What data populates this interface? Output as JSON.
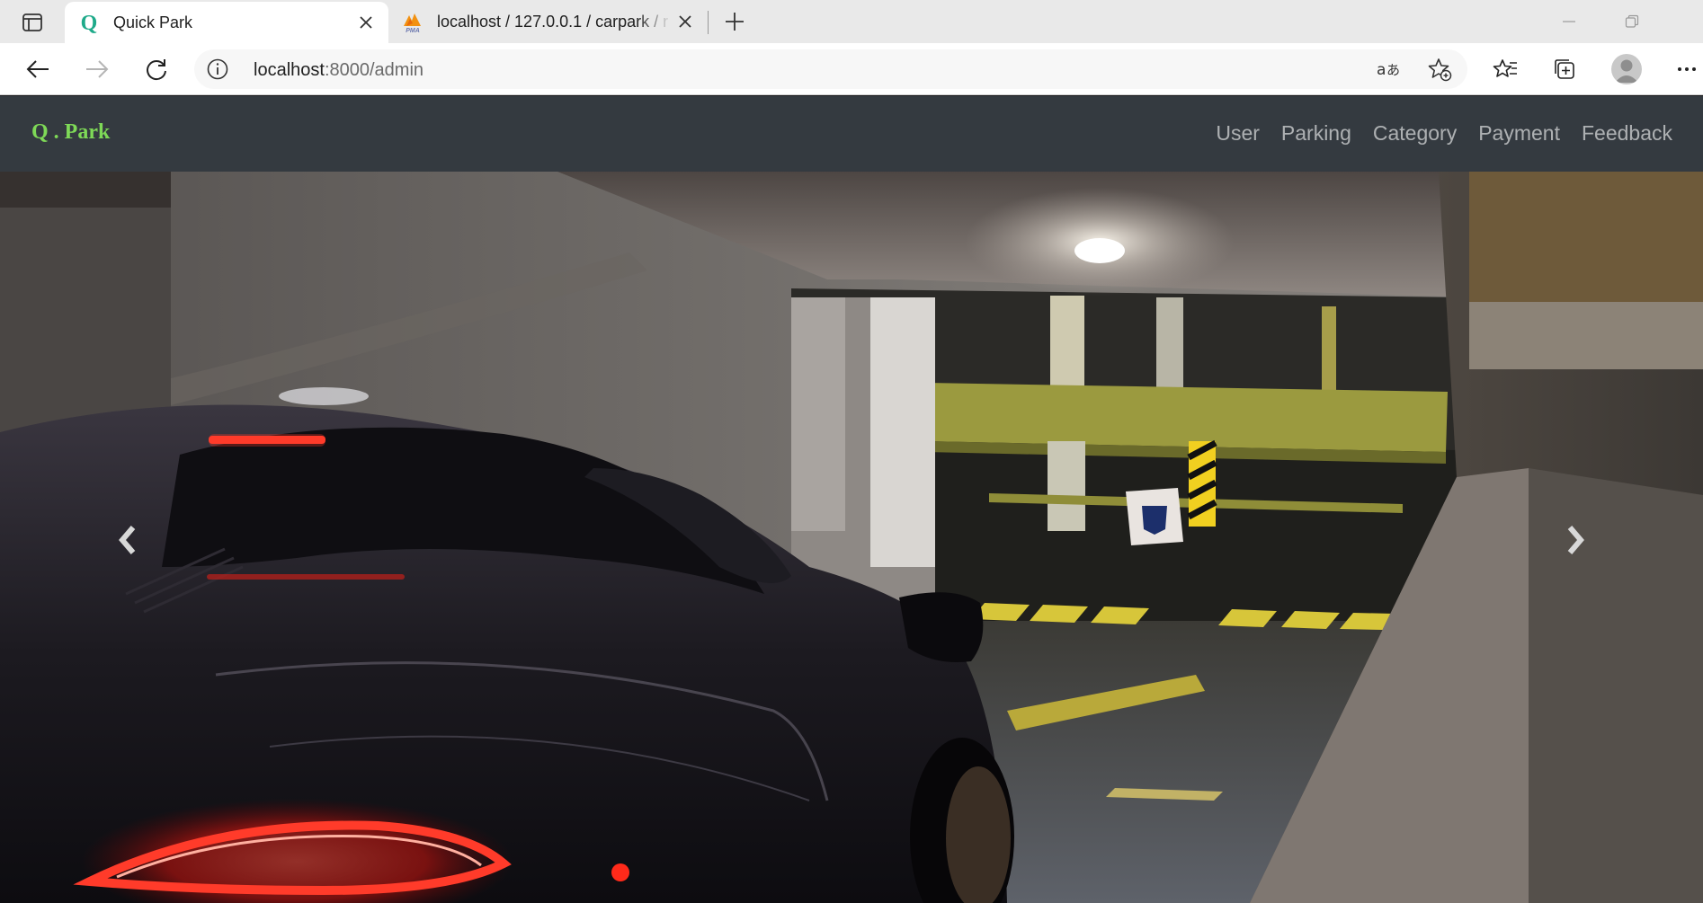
{
  "browser": {
    "tabs": [
      {
        "title": "Quick Park",
        "favicon": "q-logo-icon",
        "active": true
      },
      {
        "title": "localhost / 127.0.0.1 / carpark / r",
        "favicon": "phpmyadmin-icon",
        "active": false
      }
    ],
    "address": {
      "host": "localhost",
      "path": ":8000/admin"
    }
  },
  "site": {
    "brand": "Q . Park",
    "brand_color": "#7ed957",
    "nav": [
      {
        "label": "User"
      },
      {
        "label": "Parking"
      },
      {
        "label": "Category"
      },
      {
        "label": "Payment"
      },
      {
        "label": "Feedback"
      }
    ],
    "navbar_color": "#343a40",
    "carousel": {
      "slide": "black sports car in underground parking garage",
      "prev_icon": "chevron-left-icon",
      "next_icon": "chevron-right-icon"
    }
  }
}
